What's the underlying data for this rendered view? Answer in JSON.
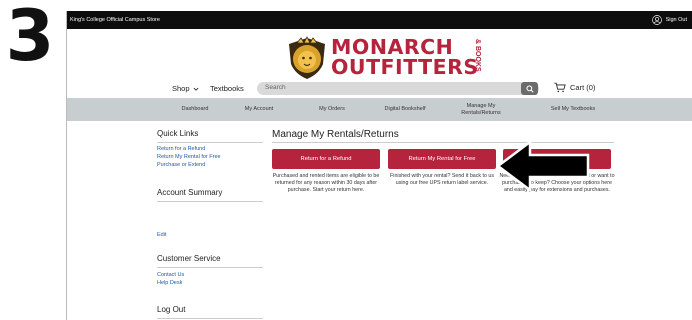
{
  "step_number": "3",
  "topbar": {
    "store_name": "King's College Official Campus Store",
    "sign_out": "Sign Out"
  },
  "logo": {
    "line1": "MONARCH",
    "line2": "OUTFITTERS",
    "suffix": "& BOOKS"
  },
  "nav": {
    "shop": "Shop",
    "textbooks": "Textbooks",
    "search_placeholder": "Search",
    "cart": "Cart (0)"
  },
  "subnav": [
    "Dashboard",
    "My Account",
    "My Orders",
    "Digital Bookshelf",
    "Manage My Rentals/Returns",
    "Sell My Textbooks"
  ],
  "sidebar": {
    "quick_links_title": "Quick Links",
    "quick_links": [
      "Return for a Refund",
      "Return My Rental for Free",
      "Purchase or Extend"
    ],
    "account_summary_title": "Account Summary",
    "edit_link": "Edit",
    "customer_service_title": "Customer Service",
    "customer_service_links": [
      "Contact Us",
      "Help Desk"
    ],
    "log_out_title": "Log Out"
  },
  "main": {
    "title": "Manage My Rentals/Returns",
    "buttons": [
      {
        "label": "Return for a Refund",
        "description": "Purchased and rented items are eligible to be returned for any reason within 30 days after purchase. Start your return here."
      },
      {
        "label": "Return My Rental for Free",
        "description": "Finished with your rental? Send it back to us using our free UPS return label service."
      },
      {
        "label": "Extend",
        "description": "Need a little more time with your rental or want to purchase it to keep? Choose your options here and easily pay for extensions and purchases."
      }
    ]
  },
  "colors": {
    "brand_red": "#b6233c",
    "topbar_black": "#0d0d0d",
    "subnav_gray": "#c8cdd0",
    "link_blue": "#1e5aa8"
  },
  "icons": {
    "user": "user-circle-icon",
    "search": "search-icon",
    "cart": "cart-icon",
    "chevron": "chevron-down-icon",
    "pointer": "arrow-left-icon"
  }
}
